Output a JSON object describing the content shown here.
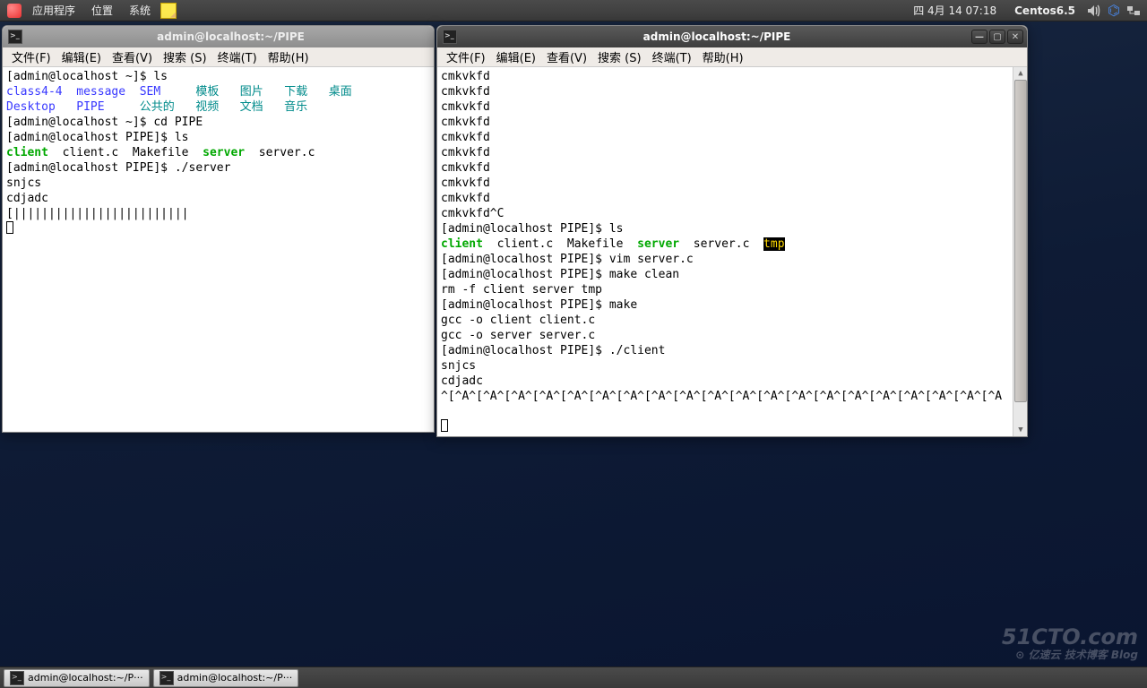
{
  "panel": {
    "apps": "应用程序",
    "places": "位置",
    "system": "系统",
    "datetime": "四 4月  14 07:18",
    "host": "Centos6.5"
  },
  "win1": {
    "title": "admin@localhost:~/PIPE",
    "menus": [
      "文件(F)",
      "编辑(E)",
      "查看(V)",
      "搜索 (S)",
      "终端(T)",
      "帮助(H)"
    ],
    "lines": {
      "p1": "[admin@localhost ~]$ ls",
      "dirs1": "class4-4  message  SEM",
      "dirs1b": "     模板   图片   下载   桌面",
      "dirs2": "Desktop   PIPE",
      "dirs2b": "     公共的   视频   文档   音乐",
      "p2": "[admin@localhost ~]$ cd PIPE",
      "p3": "[admin@localhost PIPE]$ ls",
      "client": "client",
      "mid": "  client.c  Makefile  ",
      "server": "server",
      "serverc": "  server.c",
      "p4": "[admin@localhost PIPE]$ ./server",
      "o1": "snjcs",
      "o2": "cdjadc",
      "o3": "[|||||||||||||||||||||||||"
    }
  },
  "win2": {
    "title": "admin@localhost:~/PIPE",
    "menus": [
      "文件(F)",
      "编辑(E)",
      "查看(V)",
      "搜索 (S)",
      "终端(T)",
      "帮助(H)"
    ],
    "lines": {
      "r1": "cmkvkfd",
      "r2": "cmkvkfd",
      "r3": "cmkvkfd",
      "r4": "cmkvkfd",
      "r5": "cmkvkfd",
      "r6": "cmkvkfd",
      "r7": "cmkvkfd",
      "r8": "cmkvkfd",
      "r9": "cmkvkfd",
      "r10": "cmkvkfd^C",
      "p1": "[admin@localhost PIPE]$ ls",
      "client": "client",
      "mid": "  client.c  Makefile  ",
      "server": "server",
      "serverc": "  server.c  ",
      "tmp": "tmp",
      "p2": "[admin@localhost PIPE]$ vim server.c",
      "p3": "[admin@localhost PIPE]$ make clean",
      "o1": "rm -f client server tmp",
      "p4": "[admin@localhost PIPE]$ make",
      "o2": "gcc -o client client.c",
      "o3": "gcc -o server server.c",
      "p5": "[admin@localhost PIPE]$ ./client",
      "o4": "snjcs",
      "o5": "cdjadc",
      "o6": "^[^A^[^A^[^A^[^A^[^A^[^A^[^A^[^A^[^A^[^A^[^A^[^A^[^A^[^A^[^A^[^A^[^A^[^A^[^A^[^A"
    }
  },
  "tasks": {
    "t1": "admin@localhost:~/P···",
    "t2": "admin@localhost:~/P···"
  },
  "watermark": {
    "big": "51CTO.com",
    "small": "技术博客 Blog",
    "cloud": "亿速云"
  }
}
